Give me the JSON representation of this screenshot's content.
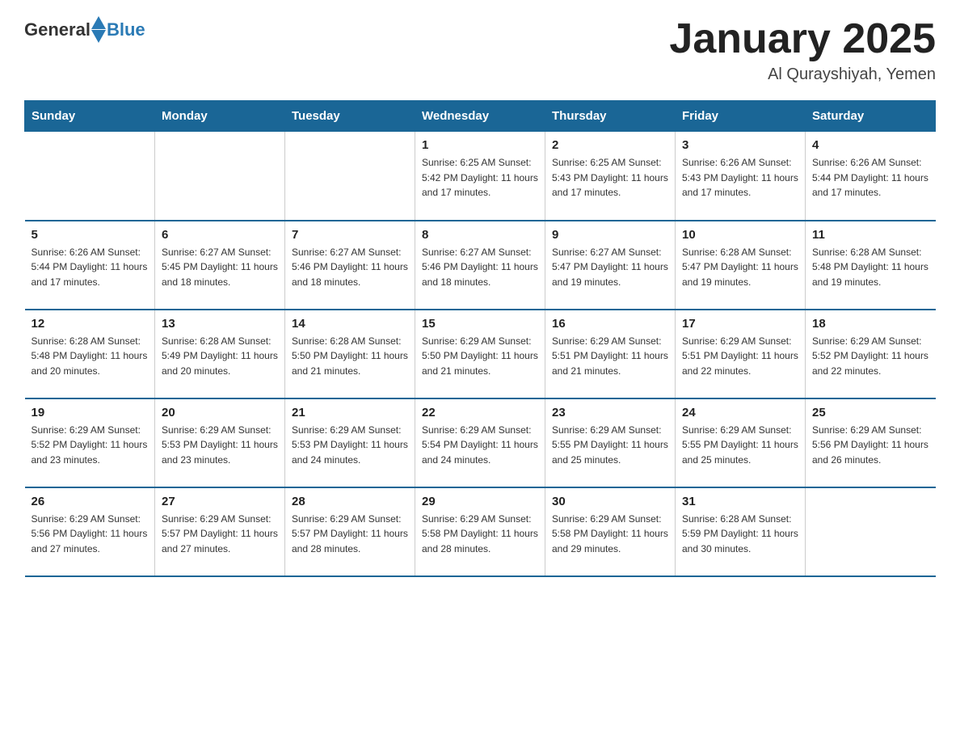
{
  "logo": {
    "text_general": "General",
    "text_blue": "Blue"
  },
  "title": "January 2025",
  "location": "Al Qurayshiyah, Yemen",
  "days_of_week": [
    "Sunday",
    "Monday",
    "Tuesday",
    "Wednesday",
    "Thursday",
    "Friday",
    "Saturday"
  ],
  "weeks": [
    [
      {
        "day": "",
        "info": ""
      },
      {
        "day": "",
        "info": ""
      },
      {
        "day": "",
        "info": ""
      },
      {
        "day": "1",
        "info": "Sunrise: 6:25 AM\nSunset: 5:42 PM\nDaylight: 11 hours and 17 minutes."
      },
      {
        "day": "2",
        "info": "Sunrise: 6:25 AM\nSunset: 5:43 PM\nDaylight: 11 hours and 17 minutes."
      },
      {
        "day": "3",
        "info": "Sunrise: 6:26 AM\nSunset: 5:43 PM\nDaylight: 11 hours and 17 minutes."
      },
      {
        "day": "4",
        "info": "Sunrise: 6:26 AM\nSunset: 5:44 PM\nDaylight: 11 hours and 17 minutes."
      }
    ],
    [
      {
        "day": "5",
        "info": "Sunrise: 6:26 AM\nSunset: 5:44 PM\nDaylight: 11 hours and 17 minutes."
      },
      {
        "day": "6",
        "info": "Sunrise: 6:27 AM\nSunset: 5:45 PM\nDaylight: 11 hours and 18 minutes."
      },
      {
        "day": "7",
        "info": "Sunrise: 6:27 AM\nSunset: 5:46 PM\nDaylight: 11 hours and 18 minutes."
      },
      {
        "day": "8",
        "info": "Sunrise: 6:27 AM\nSunset: 5:46 PM\nDaylight: 11 hours and 18 minutes."
      },
      {
        "day": "9",
        "info": "Sunrise: 6:27 AM\nSunset: 5:47 PM\nDaylight: 11 hours and 19 minutes."
      },
      {
        "day": "10",
        "info": "Sunrise: 6:28 AM\nSunset: 5:47 PM\nDaylight: 11 hours and 19 minutes."
      },
      {
        "day": "11",
        "info": "Sunrise: 6:28 AM\nSunset: 5:48 PM\nDaylight: 11 hours and 19 minutes."
      }
    ],
    [
      {
        "day": "12",
        "info": "Sunrise: 6:28 AM\nSunset: 5:48 PM\nDaylight: 11 hours and 20 minutes."
      },
      {
        "day": "13",
        "info": "Sunrise: 6:28 AM\nSunset: 5:49 PM\nDaylight: 11 hours and 20 minutes."
      },
      {
        "day": "14",
        "info": "Sunrise: 6:28 AM\nSunset: 5:50 PM\nDaylight: 11 hours and 21 minutes."
      },
      {
        "day": "15",
        "info": "Sunrise: 6:29 AM\nSunset: 5:50 PM\nDaylight: 11 hours and 21 minutes."
      },
      {
        "day": "16",
        "info": "Sunrise: 6:29 AM\nSunset: 5:51 PM\nDaylight: 11 hours and 21 minutes."
      },
      {
        "day": "17",
        "info": "Sunrise: 6:29 AM\nSunset: 5:51 PM\nDaylight: 11 hours and 22 minutes."
      },
      {
        "day": "18",
        "info": "Sunrise: 6:29 AM\nSunset: 5:52 PM\nDaylight: 11 hours and 22 minutes."
      }
    ],
    [
      {
        "day": "19",
        "info": "Sunrise: 6:29 AM\nSunset: 5:52 PM\nDaylight: 11 hours and 23 minutes."
      },
      {
        "day": "20",
        "info": "Sunrise: 6:29 AM\nSunset: 5:53 PM\nDaylight: 11 hours and 23 minutes."
      },
      {
        "day": "21",
        "info": "Sunrise: 6:29 AM\nSunset: 5:53 PM\nDaylight: 11 hours and 24 minutes."
      },
      {
        "day": "22",
        "info": "Sunrise: 6:29 AM\nSunset: 5:54 PM\nDaylight: 11 hours and 24 minutes."
      },
      {
        "day": "23",
        "info": "Sunrise: 6:29 AM\nSunset: 5:55 PM\nDaylight: 11 hours and 25 minutes."
      },
      {
        "day": "24",
        "info": "Sunrise: 6:29 AM\nSunset: 5:55 PM\nDaylight: 11 hours and 25 minutes."
      },
      {
        "day": "25",
        "info": "Sunrise: 6:29 AM\nSunset: 5:56 PM\nDaylight: 11 hours and 26 minutes."
      }
    ],
    [
      {
        "day": "26",
        "info": "Sunrise: 6:29 AM\nSunset: 5:56 PM\nDaylight: 11 hours and 27 minutes."
      },
      {
        "day": "27",
        "info": "Sunrise: 6:29 AM\nSunset: 5:57 PM\nDaylight: 11 hours and 27 minutes."
      },
      {
        "day": "28",
        "info": "Sunrise: 6:29 AM\nSunset: 5:57 PM\nDaylight: 11 hours and 28 minutes."
      },
      {
        "day": "29",
        "info": "Sunrise: 6:29 AM\nSunset: 5:58 PM\nDaylight: 11 hours and 28 minutes."
      },
      {
        "day": "30",
        "info": "Sunrise: 6:29 AM\nSunset: 5:58 PM\nDaylight: 11 hours and 29 minutes."
      },
      {
        "day": "31",
        "info": "Sunrise: 6:28 AM\nSunset: 5:59 PM\nDaylight: 11 hours and 30 minutes."
      },
      {
        "day": "",
        "info": ""
      }
    ]
  ]
}
